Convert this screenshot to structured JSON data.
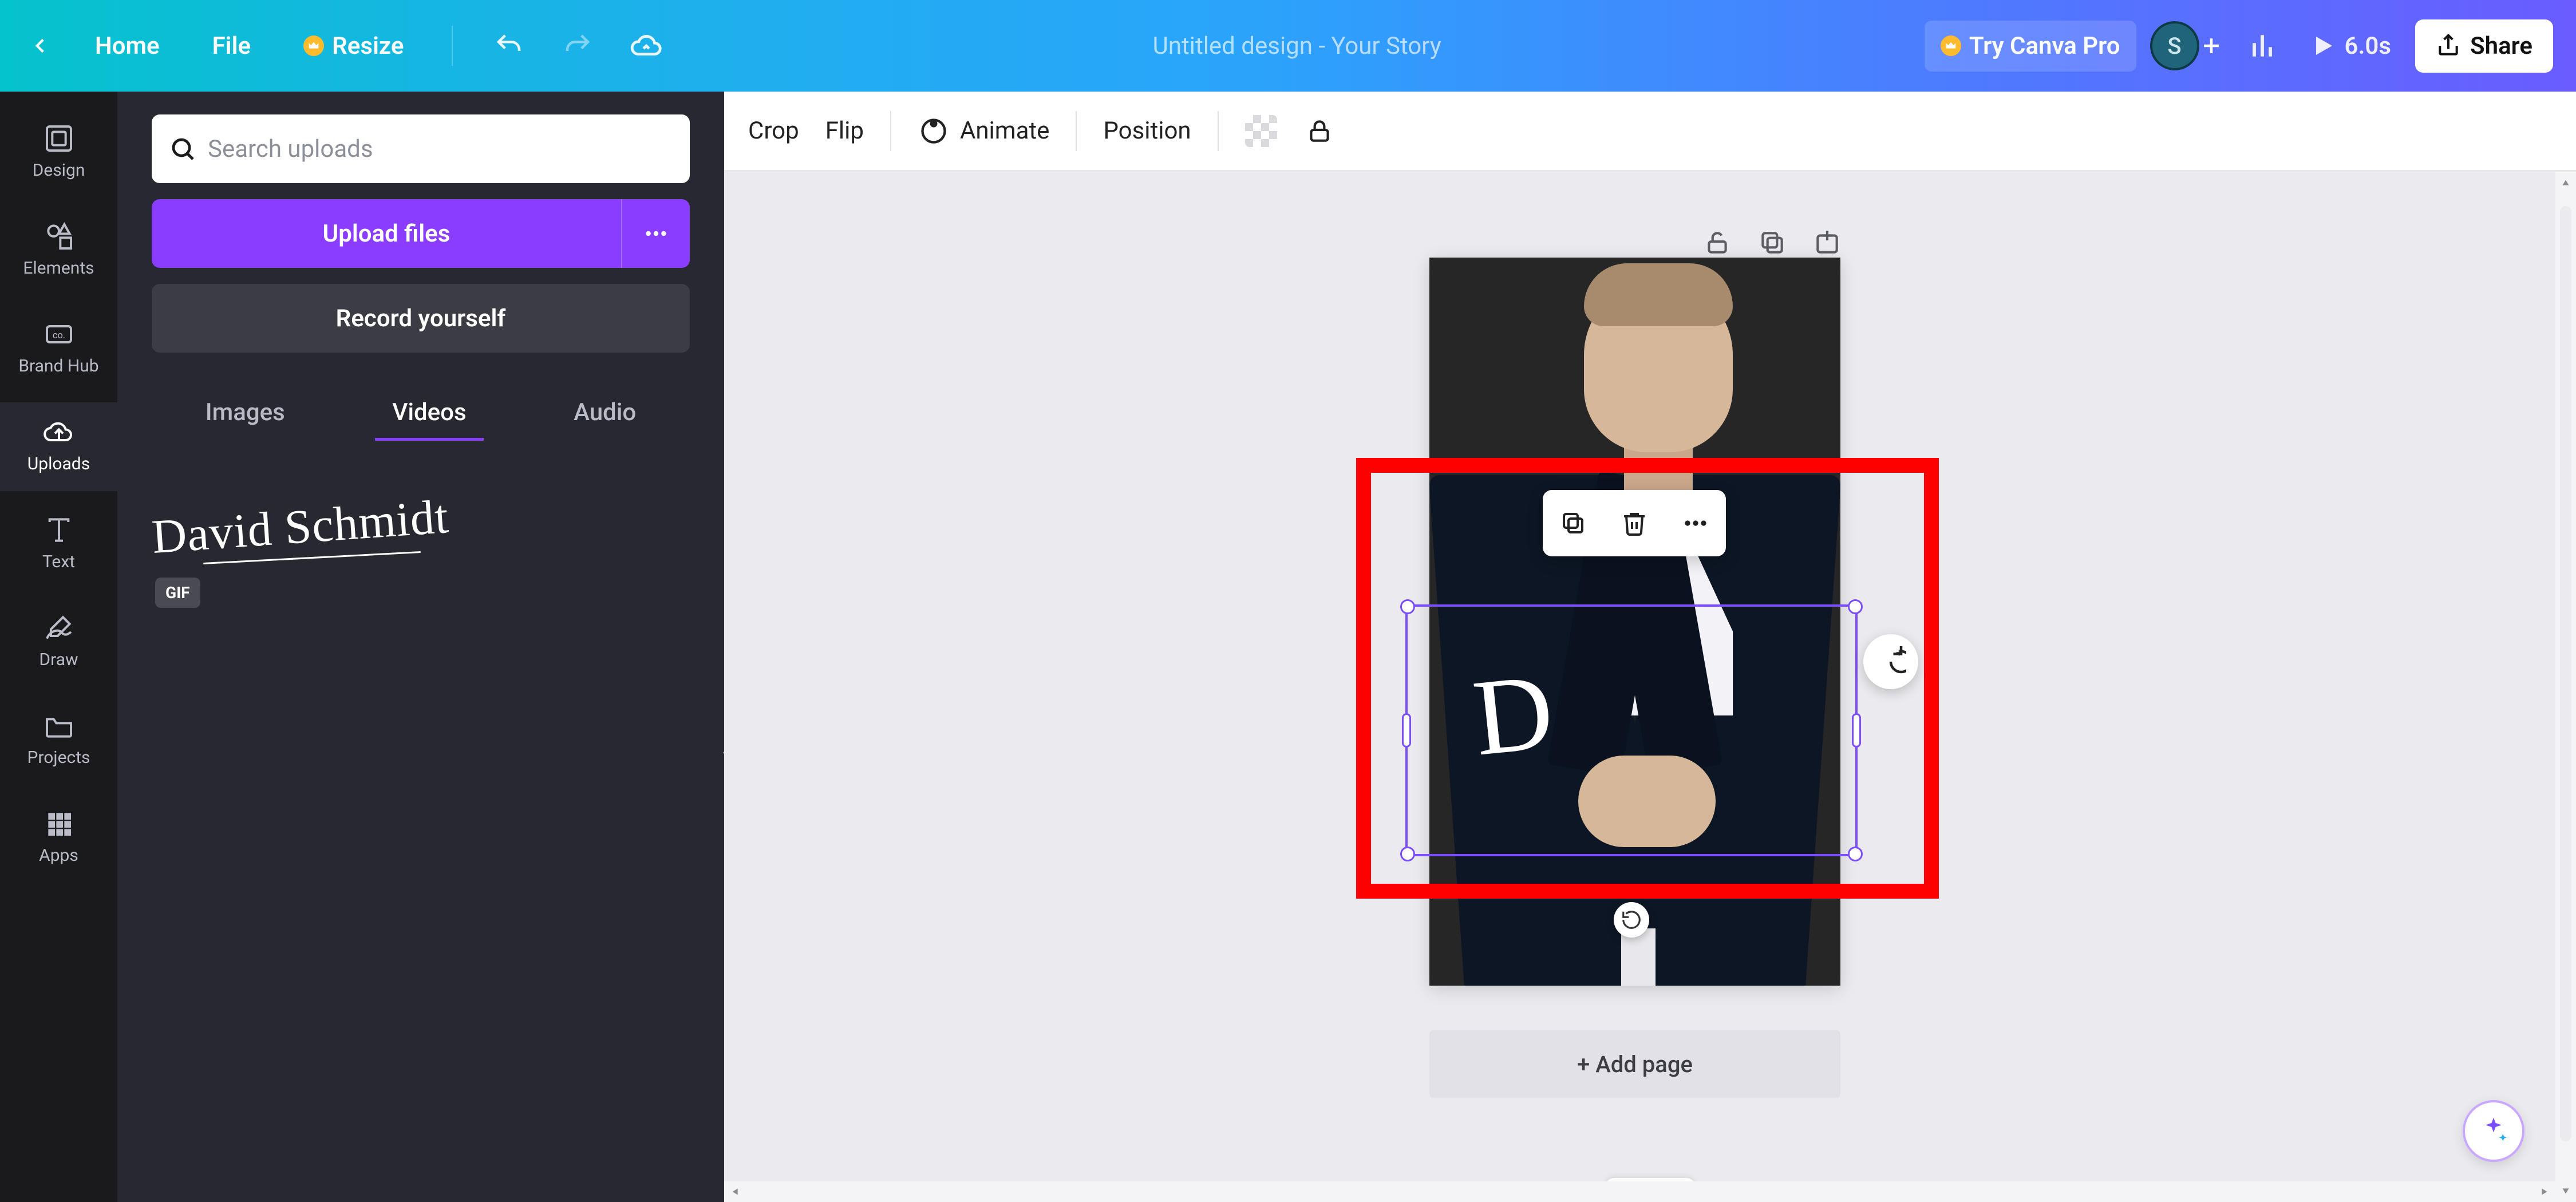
{
  "topbar": {
    "home": "Home",
    "file": "File",
    "resize": "Resize",
    "title": "Untitled design - Your Story",
    "try_pro": "Try Canva Pro",
    "avatar_initial": "S",
    "duration": "6.0s",
    "share": "Share"
  },
  "rail": {
    "items": [
      {
        "id": "design",
        "label": "Design"
      },
      {
        "id": "elements",
        "label": "Elements"
      },
      {
        "id": "brand",
        "label": "Brand Hub"
      },
      {
        "id": "uploads",
        "label": "Uploads"
      },
      {
        "id": "text",
        "label": "Text"
      },
      {
        "id": "draw",
        "label": "Draw"
      },
      {
        "id": "projects",
        "label": "Projects"
      },
      {
        "id": "apps",
        "label": "Apps"
      }
    ],
    "active": "uploads"
  },
  "panel": {
    "search_placeholder": "Search uploads",
    "upload_files": "Upload files",
    "record_yourself": "Record yourself",
    "tabs": [
      "Images",
      "Videos",
      "Audio"
    ],
    "active_tab": "Videos",
    "signature_text": "David Schmidt",
    "gif_badge": "GIF"
  },
  "context_bar": {
    "crop": "Crop",
    "flip": "Flip",
    "animate": "Animate",
    "position": "Position"
  },
  "canvas": {
    "add_page": "+ Add page",
    "signature_fragment": "D"
  },
  "colors": {
    "accent": "#8b3dff",
    "selection": "#7a4dff",
    "highlight": "#ff0000"
  }
}
